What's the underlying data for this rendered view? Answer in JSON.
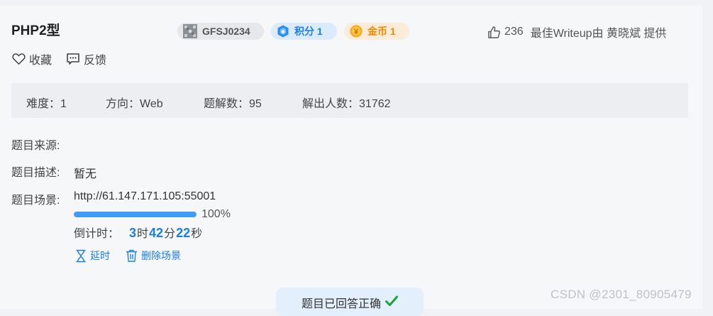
{
  "title": "PHP2型",
  "badges": {
    "code": "GFSJ0234",
    "score": "积分 1",
    "gold": "金币 1"
  },
  "likes": {
    "count": "236",
    "writeup_text": "最佳Writeup由 黄晓斌 提供"
  },
  "actions": {
    "favorite": "收藏",
    "feedback": "反馈"
  },
  "info": {
    "difficulty": "难度：1",
    "direction": "方向：Web",
    "solutions": "题解数：95",
    "solvers": "解出人数：31762"
  },
  "labels": {
    "source": "题目来源:",
    "description": "题目描述:",
    "scene": "题目场景:"
  },
  "description_value": "暂无",
  "scene": {
    "url": "http://61.147.171.105:55001",
    "progress_percent": 100,
    "progress_text": "100%",
    "countdown_label": "倒计时：",
    "hours": "3",
    "hours_unit": "时",
    "minutes": "42",
    "minutes_unit": "分",
    "seconds": "22",
    "seconds_unit": "秒",
    "extend_label": "延时",
    "delete_label": "删除场景"
  },
  "solved_text": "题目已回答正确",
  "watermark": "CSDN @2301_80905479",
  "colors": {
    "accent": "#1a7fe6",
    "progress": "#3e9cf7",
    "success": "#19a33a",
    "gold": "#f08a00"
  }
}
